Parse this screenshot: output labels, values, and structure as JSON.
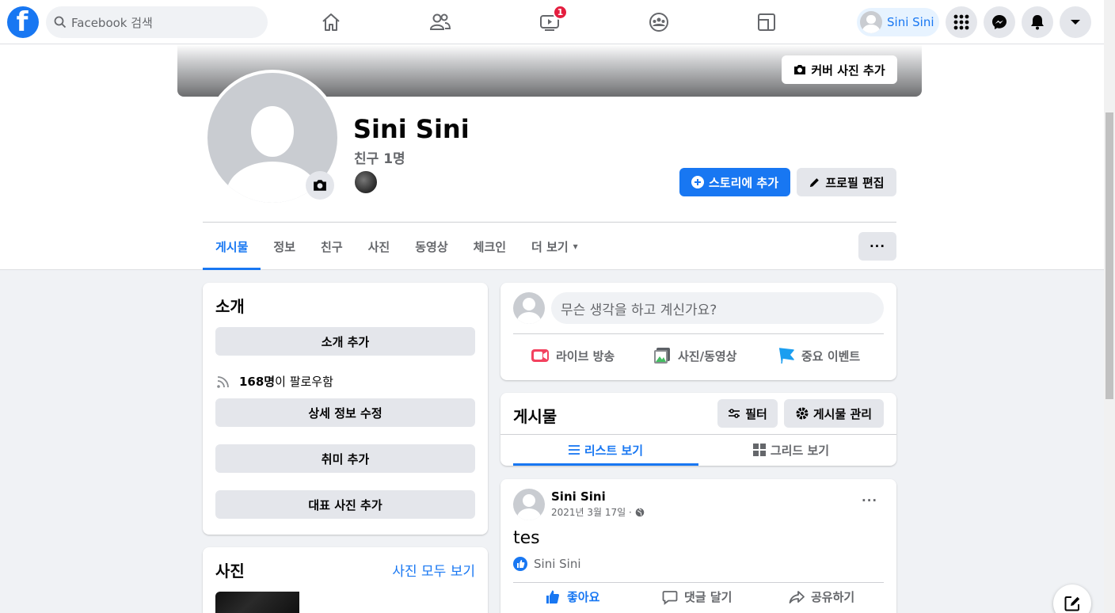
{
  "topnav": {
    "search_placeholder": "Facebook 검색",
    "watch_badge": "1",
    "user_name": "Sini Sini"
  },
  "profile": {
    "cover_button": "커버 사진 추가",
    "name": "Sini Sini",
    "friends": "친구 1명",
    "add_story": "스토리에 추가",
    "edit_profile": "프로필 편집"
  },
  "tabs": [
    "게시물",
    "정보",
    "친구",
    "사진",
    "동영상",
    "체크인",
    "더 보기"
  ],
  "tabs_more_caret": "▾",
  "more_button": "···",
  "intro": {
    "title": "소개",
    "add_bio": "소개 추가",
    "followers_count": "168명",
    "followers_suffix": "이 팔로우함",
    "edit_details": "상세 정보 수정",
    "add_hobbies": "취미 추가",
    "add_featured": "대표 사진 추가"
  },
  "photos": {
    "title": "사진",
    "see_all": "사진 모두 보기"
  },
  "composer": {
    "placeholder": "무슨 생각을 하고 계신가요?",
    "live": "라이브 방송",
    "photo_video": "사진/동영상",
    "life_event": "중요 이벤트"
  },
  "posts_header": {
    "title": "게시물",
    "filter": "필터",
    "manage": "게시물 관리",
    "list_view": "리스트 보기",
    "grid_view": "그리드 보기"
  },
  "post": {
    "author": "Sini Sini",
    "date": "2021년 3월 17일 ·",
    "text": "tes",
    "reaction_name": "Sini Sini",
    "like": "좋아요",
    "comment": "댓글 달기",
    "share": "공유하기",
    "options": "···"
  },
  "colors": {
    "brand": "#1877f2",
    "badge": "#e41e3f",
    "live_red": "#f3425f",
    "photo_green": "#45bd62",
    "event_blue": "#1877f2"
  }
}
